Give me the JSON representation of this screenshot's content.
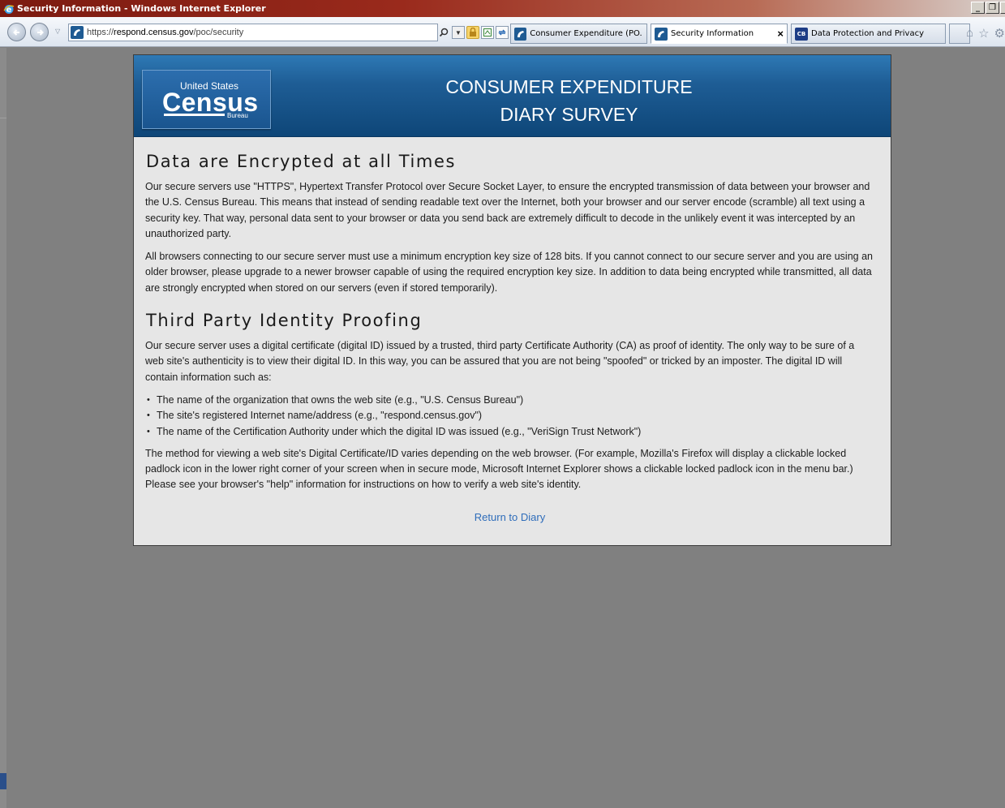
{
  "window": {
    "title": "Security Information - Windows Internet Explorer",
    "buttons": {
      "minimize": "_",
      "restore": "❐"
    }
  },
  "navbar": {
    "url_scheme": "https://",
    "url_host": "respond.census.gov",
    "url_path": "/poc/security",
    "tabs": [
      {
        "label": "Consumer Expenditure (PO...",
        "active": false
      },
      {
        "label": "Security Information",
        "active": true,
        "close": "×"
      },
      {
        "label": "Data Protection and Privacy",
        "active": false,
        "favicon_text": "CB"
      }
    ]
  },
  "header": {
    "logo_top": "United States",
    "logo_main": "Census",
    "logo_bottom": "Bureau",
    "title_line1": "CONSUMER EXPENDITURE",
    "title_line2": "DIARY SURVEY"
  },
  "content": {
    "heading1": "Data are Encrypted at all Times",
    "para1": "Our secure servers use \"HTTPS\", Hypertext Transfer Protocol over Secure Socket Layer, to ensure the encrypted transmission of data between your browser and the U.S. Census Bureau. This means that instead of sending readable text over the Internet, both your browser and our server encode (scramble) all text using a security key. That way, personal data sent to your browser or data you send back are extremely difficult to decode in the unlikely event it was intercepted by an unauthorized party.",
    "para2": "All browsers connecting to our secure server must use a minimum encryption key size of 128 bits. If you cannot connect to our secure server and you are using an older browser, please upgrade to a newer browser capable of using the required encryption key size. In addition to data being encrypted while transmitted, all data are strongly encrypted when stored on our servers (even if stored temporarily).",
    "heading2": "Third Party Identity Proofing",
    "para3": "Our secure server uses a digital certificate (digital ID) issued by a trusted, third party Certificate Authority (CA) as proof of identity. The only way to be sure of a web site's authenticity is to view their digital ID. In this way, you can be assured that you are not being \"spoofed\" or tricked by an imposter. The digital ID will contain information such as:",
    "bullets": [
      "The name of the organization that owns the web site (e.g., \"U.S. Census Bureau\")",
      "The site's registered Internet name/address (e.g., \"respond.census.gov\")",
      "The name of the Certification Authority under which the digital ID was issued (e.g., \"VeriSign Trust Network\")"
    ],
    "para4": "The method for viewing a web site's Digital Certificate/ID varies depending on the web browser. (For example, Mozilla's Firefox will display a clickable locked padlock icon in the lower right corner of your screen when in secure mode, Microsoft Internet Explorer shows a clickable locked padlock icon in the menu bar.) Please see your browser's \"help\" information for instructions on how to verify a web site's identity.",
    "return_link": "Return to Diary"
  },
  "colors": {
    "header_blue": "#1e5d95",
    "link_blue": "#2f6dba",
    "page_background": "#808080",
    "card_background": "#e6e6e6"
  }
}
